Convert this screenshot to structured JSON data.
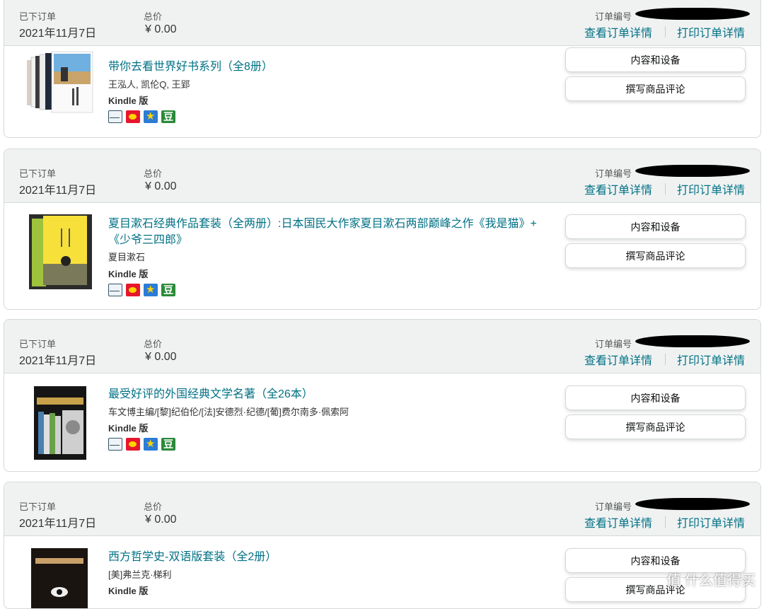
{
  "labels": {
    "placed": "已下订单",
    "total": "总价",
    "order_no": "订单编号",
    "view_details": "查看订单详情",
    "print_details": "打印订单详情",
    "btn_content": "内容和设备",
    "btn_review": "撰写商品评论",
    "douban": "豆"
  },
  "orders": [
    {
      "date": "2021年11月7日",
      "total": "¥ 0.00",
      "title": "带你去看世界好书系列（全8册）",
      "author": "王泓人, 凯伦Q, 王郢",
      "format": "Kindle 版"
    },
    {
      "date": "2021年11月7日",
      "total": "¥ 0.00",
      "title": "夏目漱石经典作品套装（全两册）:日本国民大作家夏目漱石两部巅峰之作《我是猫》+《少爷三四郎》",
      "author": "夏目漱石",
      "format": "Kindle 版"
    },
    {
      "date": "2021年11月7日",
      "total": "¥ 0.00",
      "title": "最受好评的外国经典文学名著（全26本）",
      "author": "车文博主编/[黎]纪伯伦/[法]安德烈·纪德/[葡]费尔南多·佩索阿",
      "format": "Kindle 版"
    },
    {
      "date": "2021年11月7日",
      "total": "¥ 0.00",
      "title": "西方哲学史-双语版套装（全2册）",
      "author": "[美]弗兰克·梯利",
      "format": "Kindle 版"
    }
  ],
  "watermark": "值 什么值得买"
}
